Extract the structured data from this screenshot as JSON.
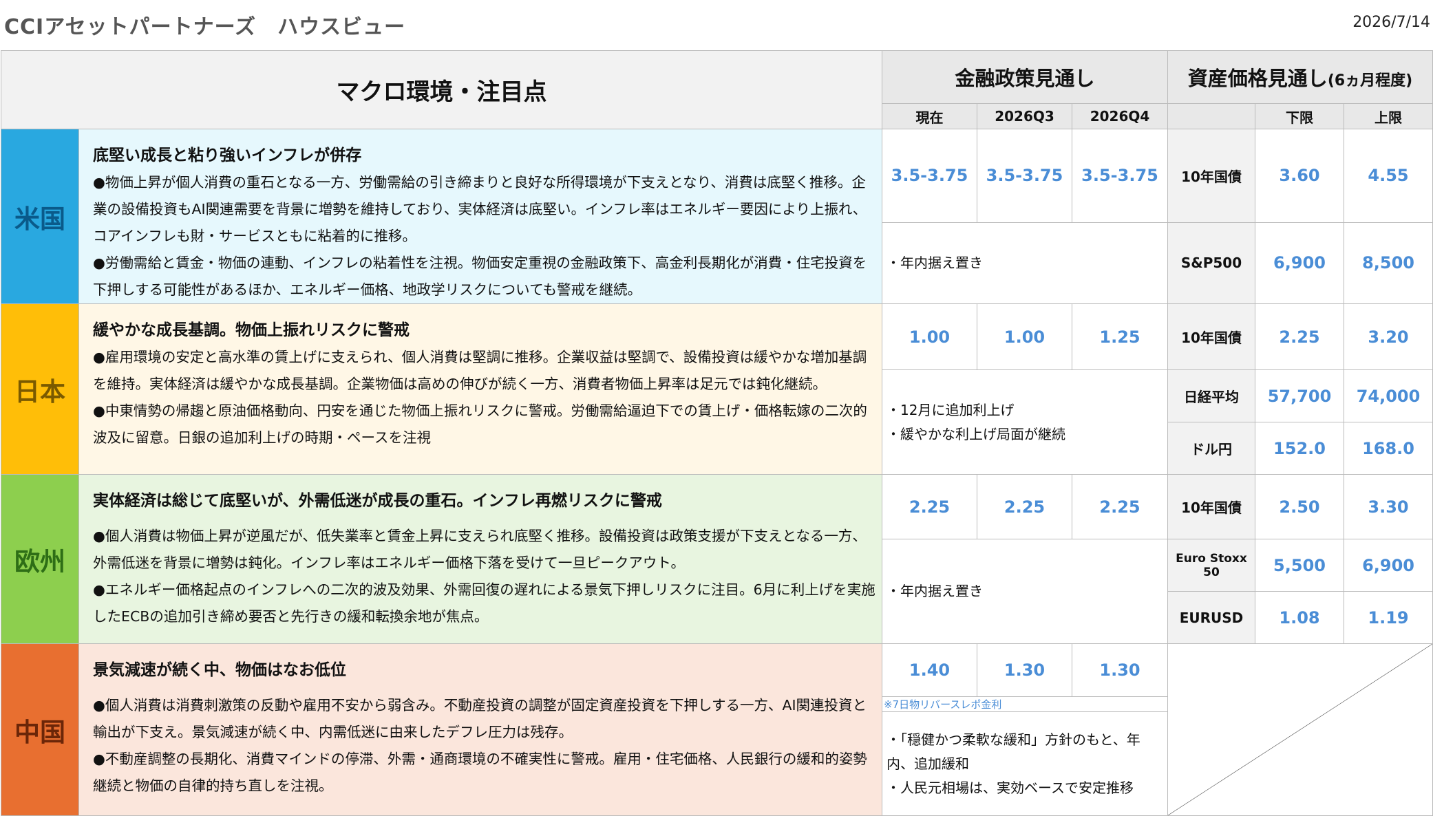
{
  "header": {
    "title": "CCIアセットパートナーズ　ハウスビュー",
    "date": "2026/7/14"
  },
  "table_headers": {
    "macro": "マクロ環境・注目点",
    "policy": "金融政策見通し",
    "asset_main": "資産価格見通し",
    "asset_sub": "(6ヵ月程度)",
    "policy_cols": [
      "現在",
      "2026Q3",
      "2026Q4"
    ],
    "asset_cols": [
      "下限",
      "上限"
    ]
  },
  "regions": [
    {
      "key": "us",
      "name": "米国",
      "headline": "底堅い成長と粘り強いインフレが併存",
      "paragraphs": [
        "●物価上昇が個人消費の重石となる一方、労働需給の引き締まりと良好な所得環境が下支えとなり、消費は底堅く推移。企業の設備投資もAI関連需要を背景に増勢を維持しており、実体経済は底堅い。インフレ率はエネルギー要因により上振れ、コアインフレも財・サービスともに粘着的に推移。",
        "●労働需給と賃金・物価の連動、インフレの粘着性を注視。物価安定重視の金融政策下、高金利長期化が消費・住宅投資を下押しする可能性があるほか、エネルギー価格、地政学リスクについても警戒を継続。"
      ],
      "rates": [
        "3.5-3.75",
        "3.5-3.75",
        "3.5-3.75"
      ],
      "policy_notes": [
        "・年内据え置き"
      ],
      "assets": [
        {
          "label": "10年国債",
          "low": "3.60",
          "high": "4.55"
        },
        {
          "label": "S&P500",
          "low": "6,900",
          "high": "8,500"
        }
      ]
    },
    {
      "key": "jp",
      "name": "日本",
      "headline": "緩やかな成長基調。物価上振れリスクに警戒",
      "paragraphs": [
        "●雇用環境の安定と高水準の賃上げに支えられ、個人消費は堅調に推移。企業収益は堅調で、設備投資は緩やかな増加基調を維持。実体経済は緩やかな成長基調。企業物価は高めの伸びが続く一方、消費者物価上昇率は足元では鈍化継続。",
        "●中東情勢の帰趨と原油価格動向、円安を通じた物価上振れリスクに警戒。労働需給逼迫下での賃上げ・価格転嫁の二次的波及に留意。日銀の追加利上げの時期・ペースを注視"
      ],
      "rates": [
        "1.00",
        "1.00",
        "1.25"
      ],
      "policy_notes": [
        "・12月に追加利上げ",
        "・緩やかな利上げ局面が継続"
      ],
      "assets": [
        {
          "label": "10年国債",
          "low": "2.25",
          "high": "3.20"
        },
        {
          "label": "日経平均",
          "low": "57,700",
          "high": "74,000"
        },
        {
          "label": "ドル円",
          "low": "152.0",
          "high": "168.0"
        }
      ]
    },
    {
      "key": "eu",
      "name": "欧州",
      "headline": "実体経済は総じて底堅いが、外需低迷が成長の重石。インフレ再燃リスクに警戒",
      "paragraphs": [
        "●個人消費は物価上昇が逆風だが、低失業率と賃金上昇に支えられ底堅く推移。設備投資は政策支援が下支えとなる一方、外需低迷を背景に増勢は鈍化。インフレ率はエネルギー価格下落を受けて一旦ピークアウト。",
        "●エネルギー価格起点のインフレへの二次的波及効果、外需回復の遅れによる景気下押しリスクに注目。6月に利上げを実施したECBの追加引き締め要否と先行きの緩和転換余地が焦点。"
      ],
      "rates": [
        "2.25",
        "2.25",
        "2.25"
      ],
      "policy_notes": [
        "・年内据え置き"
      ],
      "assets": [
        {
          "label": "10年国債",
          "low": "2.50",
          "high": "3.30"
        },
        {
          "label": "Euro Stoxx 50",
          "low": "5,500",
          "high": "6,900"
        },
        {
          "label": "EURUSD",
          "low": "1.08",
          "high": "1.19"
        }
      ]
    },
    {
      "key": "cn",
      "name": "中国",
      "headline": "景気減速が続く中、物価はなお低位",
      "paragraphs": [
        "●個人消費は消費刺激策の反動や雇用不安から弱含み。不動産投資の調整が固定資産投資を下押しする一方、AI関連投資と輸出が下支え。景気減速が続く中、内需低迷に由来したデフレ圧力は残存。",
        "●不動産調整の長期化、消費マインドの停滞、外需・通商環境の不確実性に警戒。雇用・住宅価格、人民銀行の緩和的姿勢継続と物価の自律的持ち直しを注視。"
      ],
      "rates": [
        "1.40",
        "1.30",
        "1.30"
      ],
      "rate_note": "※7日物リバースレポ金利",
      "policy_notes": [
        "・「穏健かつ柔軟な緩和」方針のもと、年内、追加緩和",
        "・人民元相場は、実効ベースで安定推移"
      ],
      "assets": []
    }
  ]
}
